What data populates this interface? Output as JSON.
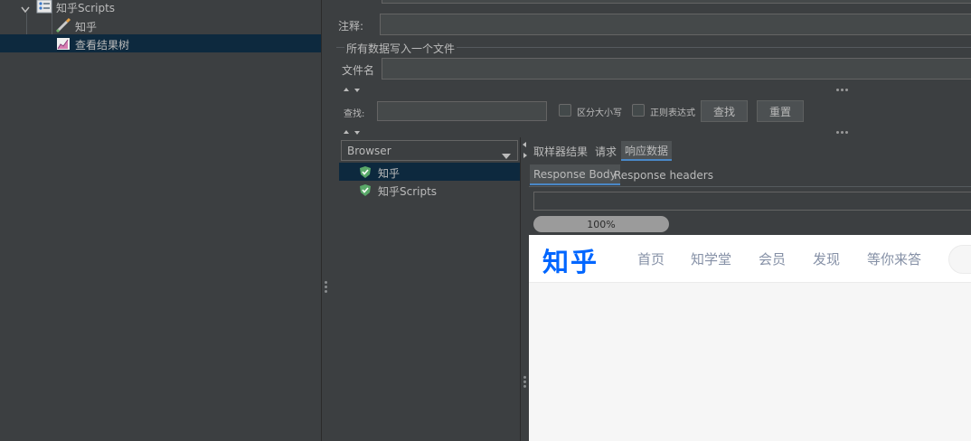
{
  "tree": {
    "root_label": "知乎Scripts",
    "items": [
      {
        "label": "知乎",
        "icon": "sampler-pen-icon"
      },
      {
        "label": "查看结果树",
        "icon": "chart-listener-icon"
      }
    ]
  },
  "config": {
    "comment_label": "注释:",
    "file_section_title": "所有数据写入一个文件",
    "filename_label": "文件名",
    "search_label": "查找:",
    "case_sensitive_label": "区分大小写",
    "regex_label": "正则表达式",
    "find_button": "查找",
    "reset_button": "重置"
  },
  "results": {
    "renderer_selected": "Browser",
    "samples": [
      {
        "label": "知乎",
        "status": "success"
      },
      {
        "label": "知乎Scripts",
        "status": "success"
      }
    ],
    "tabs": [
      "取样器结果",
      "请求",
      "响应数据"
    ],
    "active_tab": "响应数据",
    "subtabs": [
      "Response Body",
      "Response headers"
    ],
    "active_subtab": "Response Body",
    "progress_text": "100%",
    "progress_value": 1.0
  },
  "webpage": {
    "logo": "知乎",
    "nav": [
      "首页",
      "知学堂",
      "会员",
      "发现",
      "等你来答"
    ],
    "logo_color": "#0066ff"
  },
  "colors": {
    "panel_bg": "#3c3f41",
    "selected_row": "#0d293e",
    "accent": "#4a88c7",
    "success_green": "#59a869"
  }
}
